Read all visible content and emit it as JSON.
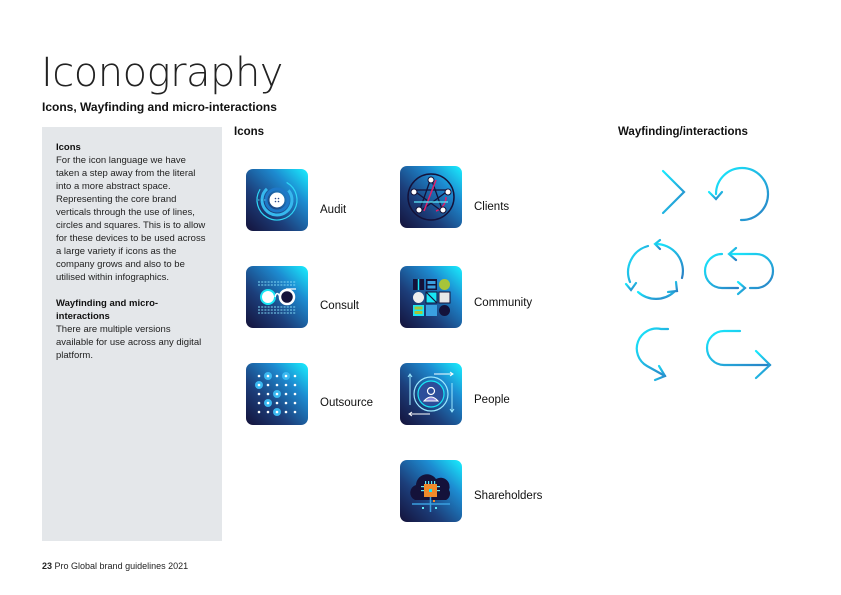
{
  "header": {
    "title": "Iconography",
    "subtitle": "Icons, Wayfinding and  micro-interactions"
  },
  "sidebar": {
    "sections": [
      {
        "heading": "Icons",
        "body": "For the icon language we have taken a step away from the literal into a more abstract space. Representing the core brand verticals through the use of lines, circles and squares. This is to allow for these devices to be used across a large variety if icons as the company grows and also to be utilised within infographics."
      },
      {
        "heading": "Wayfinding and micro-interactions",
        "body": "There are multiple versions available for use across any digital platform."
      }
    ]
  },
  "icons_section": {
    "label": "Icons",
    "items": [
      {
        "label": "Audit",
        "icon": "audit-icon"
      },
      {
        "label": "Consult",
        "icon": "consult-icon"
      },
      {
        "label": "Outsource",
        "icon": "outsource-icon"
      },
      {
        "label": "Clients",
        "icon": "clients-icon"
      },
      {
        "label": "Community",
        "icon": "community-icon"
      },
      {
        "label": "People",
        "icon": "people-icon"
      },
      {
        "label": "Shareholders",
        "icon": "shareholders-icon"
      }
    ]
  },
  "wayfinding_section": {
    "label": "Wayfinding/interactions",
    "items": [
      {
        "icon": "arrow-right-icon"
      },
      {
        "icon": "refresh-circle-icon"
      },
      {
        "icon": "cycle-three-arrows-icon"
      },
      {
        "icon": "loop-exchange-icon"
      },
      {
        "icon": "curved-return-arrow-icon"
      },
      {
        "icon": "u-turn-arrow-icon"
      }
    ]
  },
  "colors": {
    "accent_cyan": "#18e6f5",
    "accent_blue": "#2a7fc4",
    "tile_dark": "#14123a",
    "sidebar_bg": "#e4e7ea"
  },
  "footer": {
    "page_number": "23",
    "text": "Pro Global brand guidelines 2021"
  }
}
